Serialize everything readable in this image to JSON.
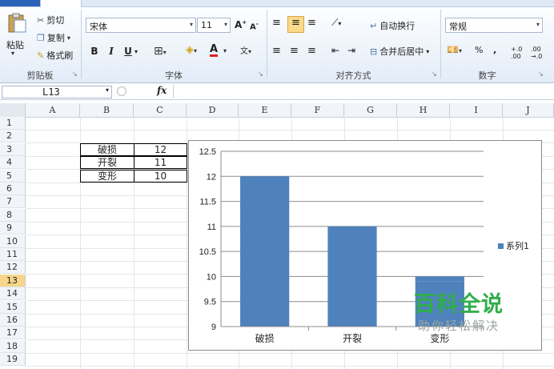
{
  "ribbon": {
    "clipboard": {
      "paste": "粘贴",
      "cut": "剪切",
      "copy": "复制",
      "format_painter": "格式刷",
      "label": "剪贴板"
    },
    "font": {
      "name": "宋体",
      "size": "11",
      "bold": "B",
      "italic": "I",
      "underline": "U",
      "label": "字体"
    },
    "alignment": {
      "wrap_text": "自动换行",
      "merge_center": "合并后居中",
      "label": "对齐方式"
    },
    "number": {
      "format": "常规",
      "percent": "%",
      "comma": ",",
      "label": "数字"
    }
  },
  "formula_bar": {
    "name_box": "L13",
    "fx": "fx",
    "value": ""
  },
  "sheet": {
    "columns": [
      "A",
      "B",
      "C",
      "D",
      "E",
      "F",
      "G",
      "H",
      "I",
      "J"
    ],
    "rows": [
      "1",
      "2",
      "3",
      "4",
      "5",
      "6",
      "7",
      "8",
      "9",
      "10",
      "11",
      "12",
      "13",
      "14",
      "15",
      "16",
      "17",
      "18",
      "19"
    ],
    "selected_row": "13",
    "table": [
      {
        "label": "破损",
        "value": "12"
      },
      {
        "label": "开裂",
        "value": "11"
      },
      {
        "label": "变形",
        "value": "10"
      }
    ]
  },
  "chart_data": {
    "type": "bar",
    "categories": [
      "破损",
      "开裂",
      "变形"
    ],
    "series": [
      {
        "name": "系列1",
        "values": [
          12,
          11,
          9.9
        ],
        "color": "#4f81bd"
      }
    ],
    "ylim": [
      9,
      12.5
    ],
    "yticks": [
      "12.5",
      "12",
      "11.5",
      "11",
      "10.5",
      "10",
      "9.5",
      "9"
    ],
    "grid": true,
    "legend": "right"
  },
  "watermark": {
    "title": "百科全说",
    "subtitle": "助你轻松解决"
  }
}
